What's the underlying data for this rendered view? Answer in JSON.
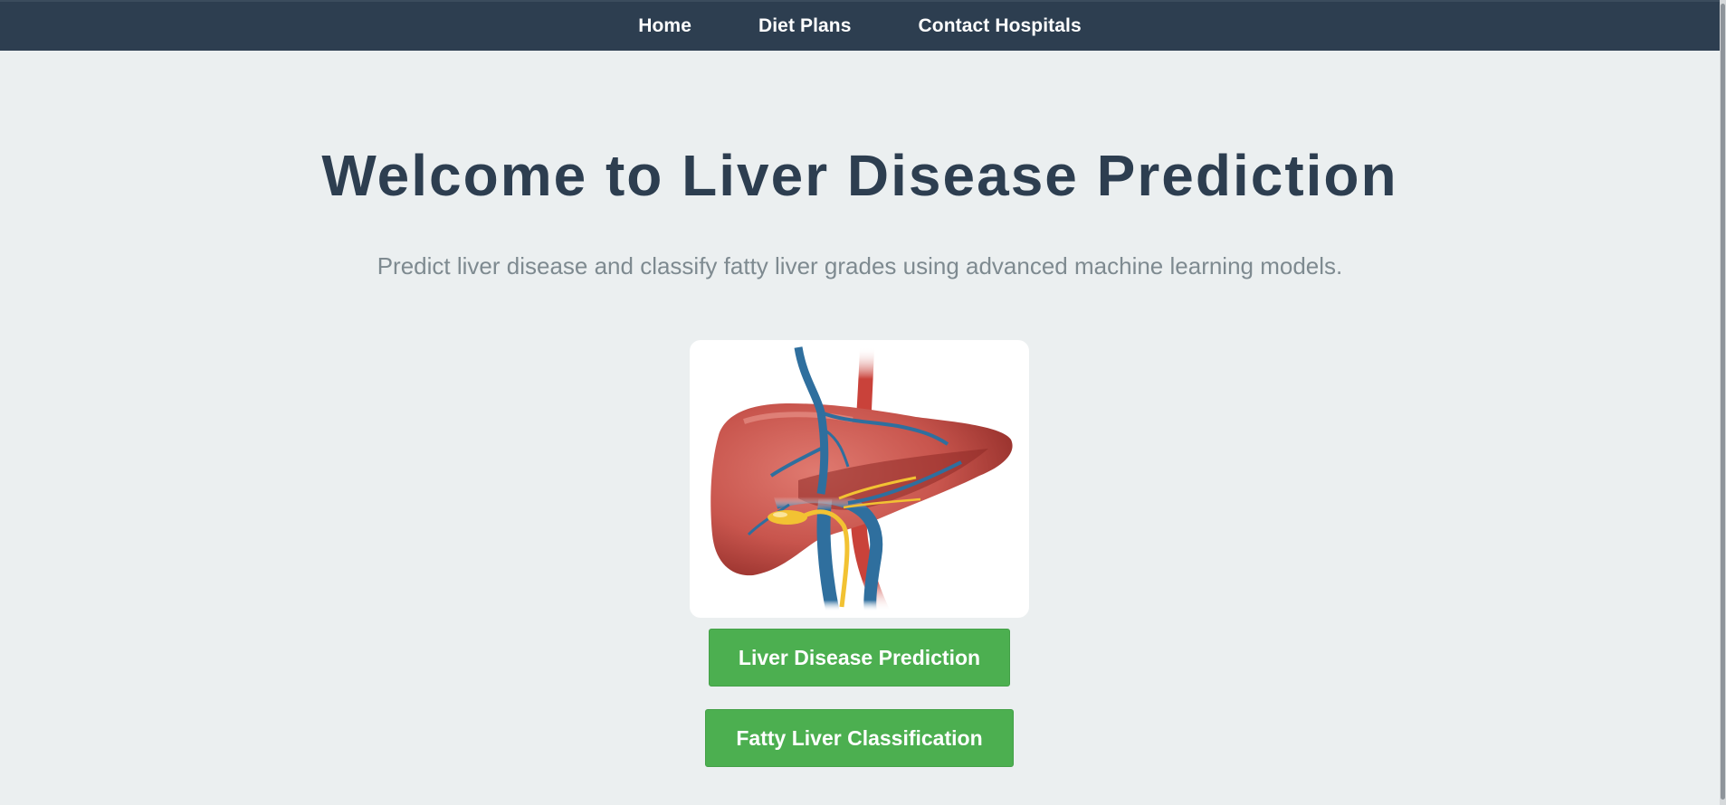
{
  "nav": {
    "items": [
      {
        "label": "Home"
      },
      {
        "label": "Diet Plans"
      },
      {
        "label": "Contact Hospitals"
      }
    ]
  },
  "hero": {
    "title": "Welcome to Liver Disease Prediction",
    "subtitle": "Predict liver disease and classify fatty liver grades using advanced machine learning models."
  },
  "illustration": {
    "icon": "liver-illustration",
    "colors": {
      "liver": "#c8554d",
      "vein": "#2f6f9e",
      "artery": "#c9423a",
      "bile_duct": "#f2c233"
    }
  },
  "actions": {
    "predict_label": "Liver Disease Prediction",
    "classify_label": "Fatty Liver Classification"
  },
  "colors": {
    "navbar": "#2d3e50",
    "background": "#ebeff0",
    "title": "#2d3e50",
    "subtitle": "#7e8a90",
    "button": "#4caf50"
  }
}
